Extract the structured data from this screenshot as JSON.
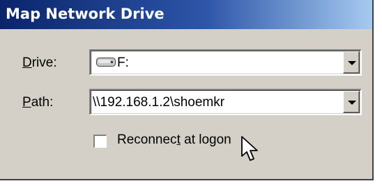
{
  "dialog": {
    "title": "Map Network Drive"
  },
  "drive": {
    "label_mnemonic": "D",
    "label_rest": "rive:",
    "value": "F:",
    "icon": "network-drive-icon"
  },
  "path": {
    "label_mnemonic": "P",
    "label_rest": "ath:",
    "value": "\\\\192.168.1.2\\shoemkr"
  },
  "reconnect": {
    "label_before": "Reconnec",
    "label_mnemonic": "t",
    "label_after": " at logon",
    "checked": false
  },
  "pointer": {
    "icon": "mouse-pointer-icon"
  },
  "colors": {
    "title_bar_start": "#0a246a",
    "title_bar_end": "#a6caf0",
    "dialog_face": "#d4d0c8"
  }
}
